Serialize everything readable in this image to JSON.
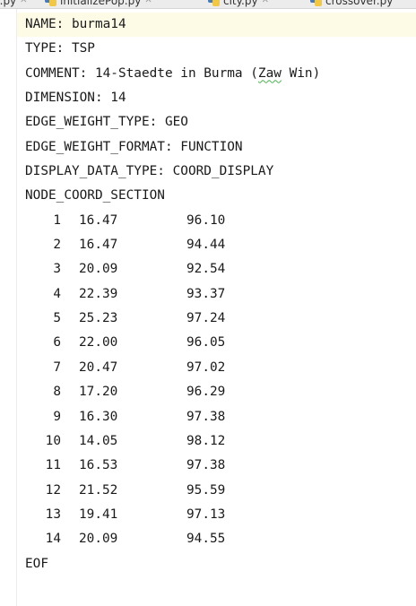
{
  "tabs": [
    {
      "name": "tab-prev",
      "label": "...py",
      "has_icon": false
    },
    {
      "name": "tab-initializepop",
      "label": "initializePop.py",
      "has_icon": true
    },
    {
      "name": "tab-city",
      "label": "city.py",
      "has_icon": true
    },
    {
      "name": "tab-crossover",
      "label": "crossover.py",
      "has_icon": true
    }
  ],
  "file": {
    "name_line": "NAME: burma14",
    "type_line": "TYPE: TSP",
    "comment_prefix": "COMMENT: 14-Staedte in Burma (",
    "comment_word": "Zaw",
    "comment_suffix": " Win)",
    "dimension_line": "DIMENSION: 14",
    "edge_weight_type_line": "EDGE_WEIGHT_TYPE: GEO",
    "edge_weight_format_line": "EDGE_WEIGHT_FORMAT: FUNCTION",
    "display_data_type_line": "DISPLAY_DATA_TYPE: COORD_DISPLAY",
    "node_coord_section_line": "NODE_COORD_SECTION",
    "nodes": [
      {
        "id": "1",
        "x": "16.47",
        "y": "96.10"
      },
      {
        "id": "2",
        "x": "16.47",
        "y": "94.44"
      },
      {
        "id": "3",
        "x": "20.09",
        "y": "92.54"
      },
      {
        "id": "4",
        "x": "22.39",
        "y": "93.37"
      },
      {
        "id": "5",
        "x": "25.23",
        "y": "97.24"
      },
      {
        "id": "6",
        "x": "22.00",
        "y": "96.05"
      },
      {
        "id": "7",
        "x": "20.47",
        "y": "97.02"
      },
      {
        "id": "8",
        "x": "17.20",
        "y": "96.29"
      },
      {
        "id": "9",
        "x": "16.30",
        "y": "97.38"
      },
      {
        "id": "10",
        "x": "14.05",
        "y": "98.12"
      },
      {
        "id": "11",
        "x": "16.53",
        "y": "97.38"
      },
      {
        "id": "12",
        "x": "21.52",
        "y": "95.59"
      },
      {
        "id": "13",
        "x": "19.41",
        "y": "97.13"
      },
      {
        "id": "14",
        "x": "20.09",
        "y": "94.55"
      }
    ],
    "eof_line": "EOF"
  },
  "colors": {
    "current_line": "#fdfbe6",
    "typo_underline": "#4caf50"
  }
}
